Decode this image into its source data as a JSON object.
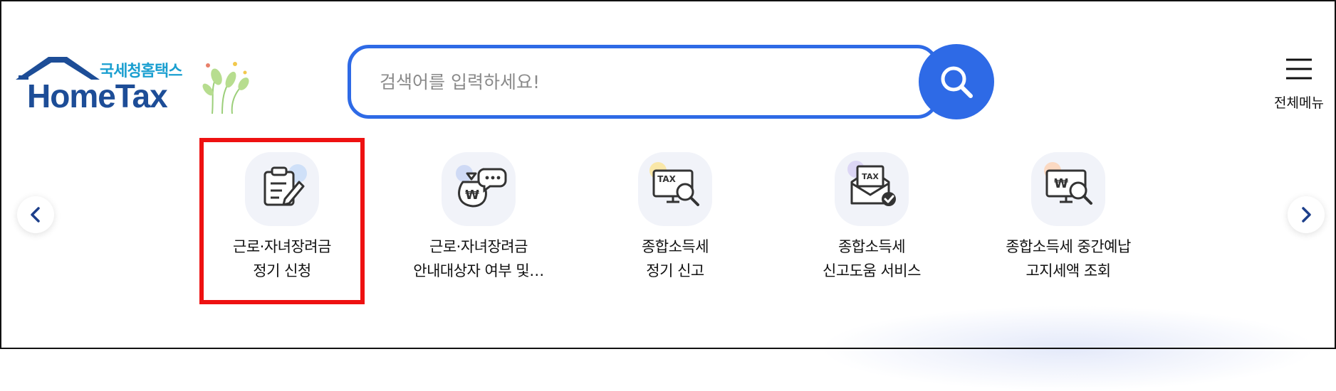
{
  "logo": {
    "sub": "국세청홈택스",
    "main": "HomeTax"
  },
  "search": {
    "placeholder": "검색어를 입력하세요!"
  },
  "header": {
    "allmenu_label": "전체메뉴"
  },
  "services": [
    {
      "line1": "근로·자녀장려금",
      "line2": "정기 신청",
      "icon": "clipboard-edit-icon"
    },
    {
      "line1": "근로·자녀장려금",
      "line2": "안내대상자 여부 및…",
      "icon": "money-bag-chat-icon"
    },
    {
      "line1": "종합소득세",
      "line2": "정기 신고",
      "icon": "tax-monitor-search-icon"
    },
    {
      "line1": "종합소득세",
      "line2": "신고도움 서비스",
      "icon": "tax-envelope-check-icon"
    },
    {
      "line1": "종합소득세 중간예납",
      "line2": "고지세액 조회",
      "icon": "won-monitor-search-icon"
    }
  ],
  "colors": {
    "brand_blue": "#2e6ae6",
    "logo_navy": "#1d4d97",
    "logo_teal": "#1a9fd0",
    "highlight": "#ee1111"
  }
}
